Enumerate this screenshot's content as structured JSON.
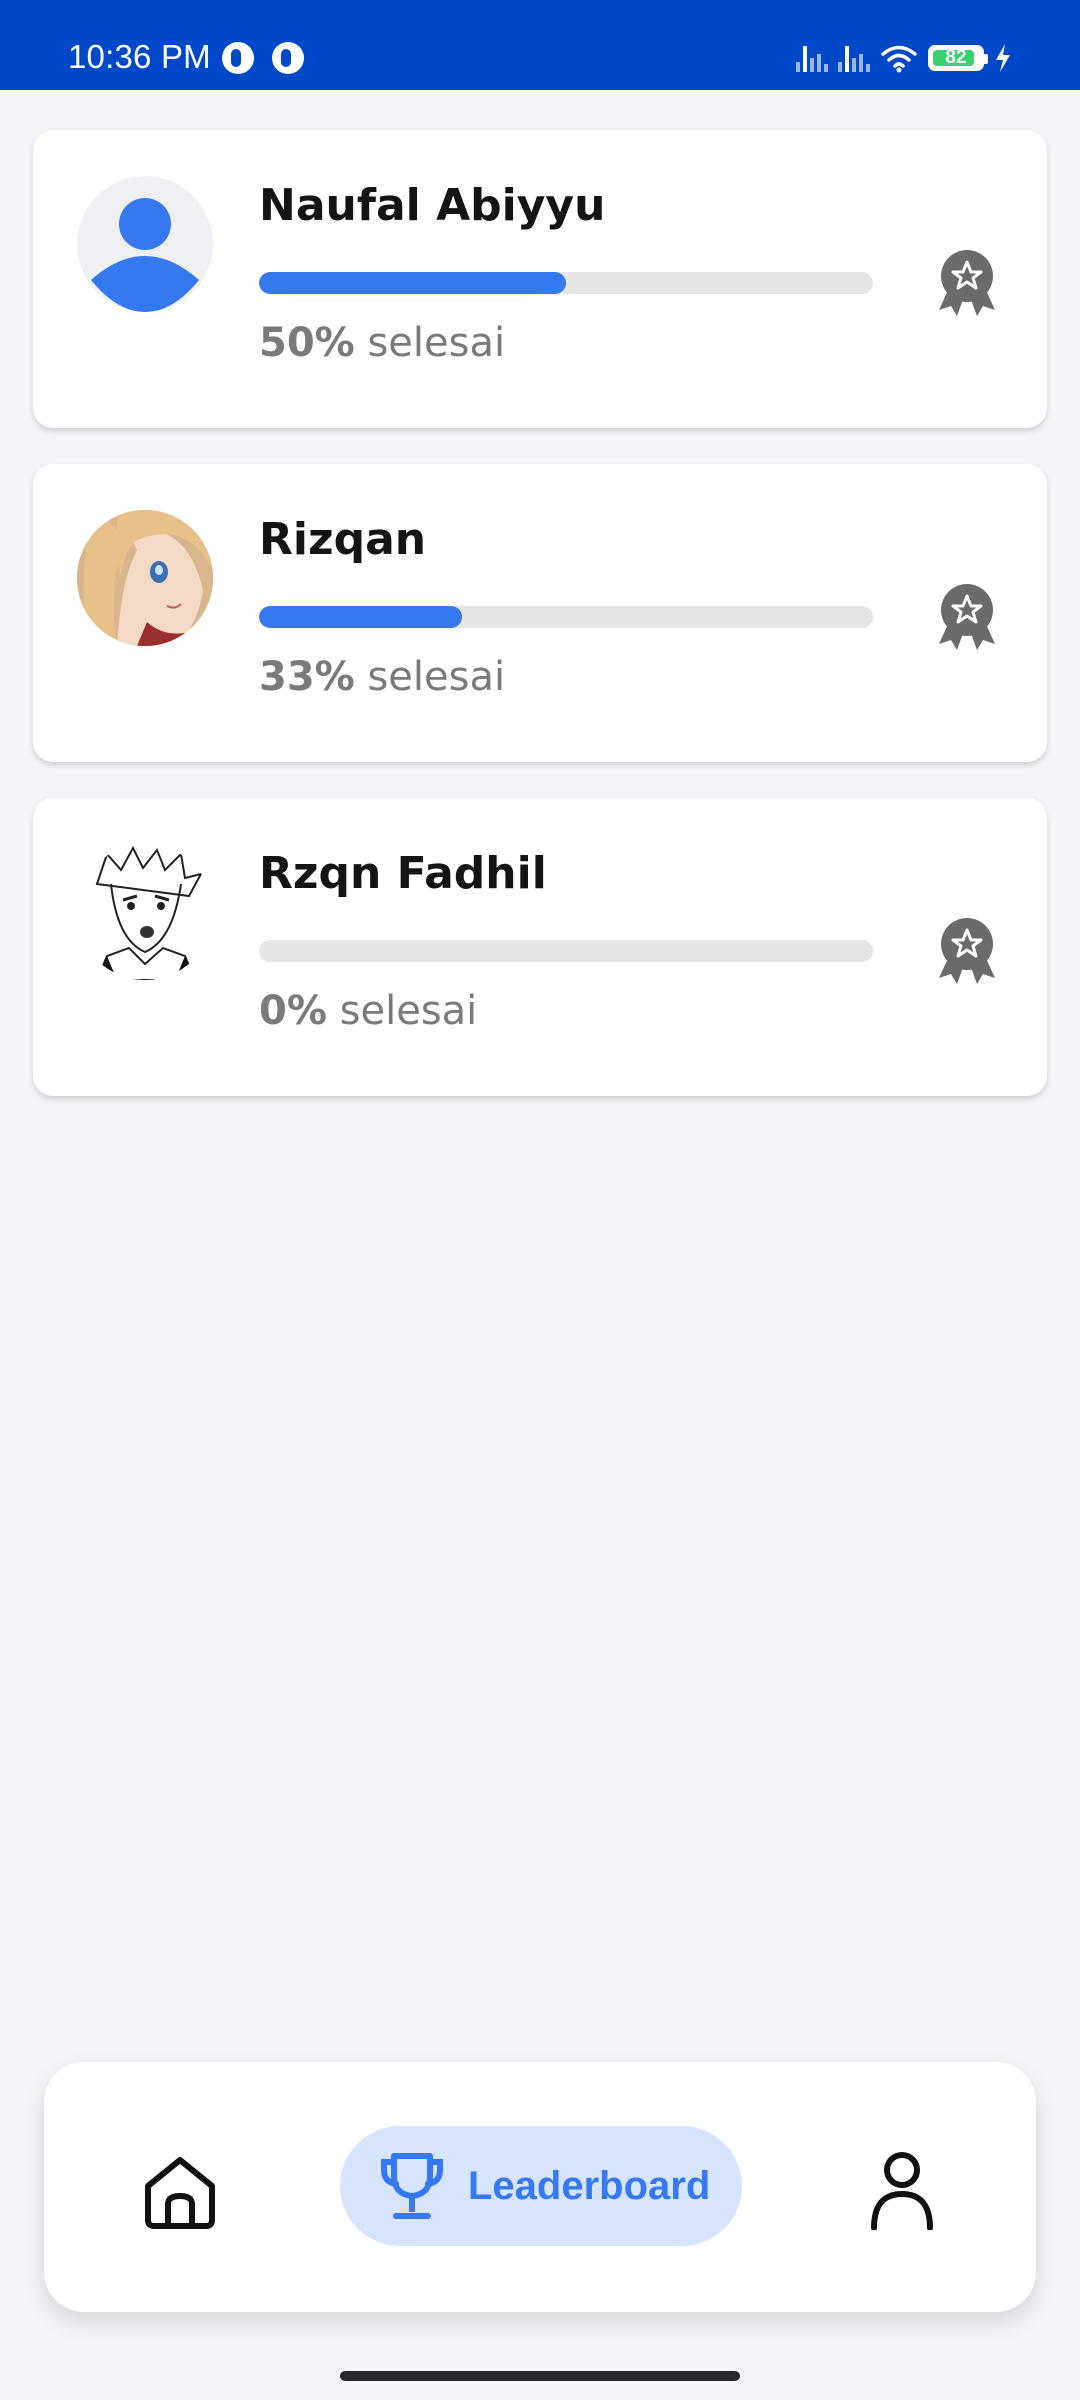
{
  "status_bar": {
    "time": "10:36 PM",
    "battery": "82",
    "background": "#0048c8"
  },
  "leaderboard": {
    "entries": [
      {
        "name": "Naufal Abiyyu",
        "percent_text": "50%",
        "suffix": "selesai",
        "progress": 0.5,
        "avatar": "default-person"
      },
      {
        "name": "Rizqan",
        "percent_text": "33%",
        "suffix": "selesai",
        "progress": 0.33,
        "avatar": "anime-girl-photo"
      },
      {
        "name": "Rzqn Fadhil",
        "percent_text": "0%",
        "suffix": "selesai",
        "progress": 0,
        "avatar": "manga-sketch-photo"
      }
    ]
  },
  "nav": {
    "home_icon": "home-icon",
    "leaderboard_label": "Leaderboard",
    "leaderboard_icon": "trophy-icon",
    "profile_icon": "person-icon"
  },
  "colors": {
    "accent": "#3678f0",
    "accent_soft": "#d6e4fd",
    "track": "#e6e6e6",
    "badge": "#6b6b6b",
    "muted_text": "#7a7a7a"
  }
}
